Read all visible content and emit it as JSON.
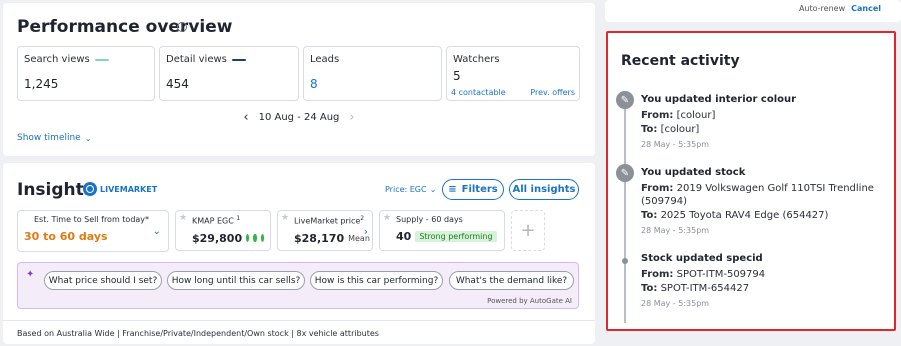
{
  "performance": {
    "title": "Performance overview",
    "info_icon": "info-circle-icon",
    "metrics": [
      {
        "label": "Search views",
        "value": "1,245",
        "swatch_color": "#7fd6c7"
      },
      {
        "label": "Detail views",
        "value": "454",
        "swatch_color": "#1f3f6e"
      },
      {
        "label": "Leads",
        "value": "8"
      },
      {
        "label": "Watchers",
        "value": "5",
        "contactable": "4 contactable",
        "prev_offers": "Prev. offers"
      }
    ],
    "date_range": "10 Aug - 24 Aug",
    "show_timeline": "Show timeline"
  },
  "insights": {
    "title": "Insights",
    "logo_text": "LIVEMARKET",
    "price_selector": "Price: EGC",
    "filters_label": "Filters",
    "all_insights_label": "All insights",
    "time_to_sell": {
      "label": "Est. Time to Sell from today*",
      "value": "30 to 60 days"
    },
    "kmap": {
      "label": "KMAP EGC",
      "sup": "1",
      "value": "$29,800"
    },
    "livemarket": {
      "label": "LiveMarket price",
      "sup": "2",
      "value": "$28,170",
      "suffix": "Mean"
    },
    "supply": {
      "label": "Supply - 60 days",
      "value": "40",
      "status": "Strong performing"
    },
    "ai_questions": [
      "What price should I set?",
      "How long until this car sells?",
      "How is this car performing?",
      "What's the demand like?"
    ],
    "powered_by": "Powered by AutoGate AI",
    "footnote": "Based on Australia Wide | Franchise/Private/Independent/Own stock | 8x vehicle attributes"
  },
  "top_right": {
    "auto_renew": "Auto-renew",
    "cancel": "Cancel"
  },
  "recent_activity": {
    "title": "Recent activity",
    "events": [
      {
        "title": "You updated interior colour",
        "from_label": "From:",
        "from": "[colour]",
        "to_label": "To:",
        "to": "[colour]",
        "time": "28 May - 5:35pm",
        "icon": "pencil-icon"
      },
      {
        "title": "You updated stock",
        "from_label": "From:",
        "from": "2019 Volkswagen Golf 110TSI Trendline (509794)",
        "to_label": "To:",
        "to": "2025 Toyota RAV4 Edge (654427)",
        "time": "28 May - 5:35pm",
        "icon": "pencil-icon"
      },
      {
        "title": "Stock updated specid",
        "from_label": "From:",
        "from": "SPOT-ITM-509794",
        "to_label": "To:",
        "to": "SPOT-ITM-654427",
        "time": "28 May - 5:35pm",
        "icon": "dot"
      }
    ]
  },
  "colors": {
    "accent": "#1a73c7",
    "highlight_border": "#e0272b",
    "warning": "#e07a12",
    "success": "#38b24a"
  }
}
